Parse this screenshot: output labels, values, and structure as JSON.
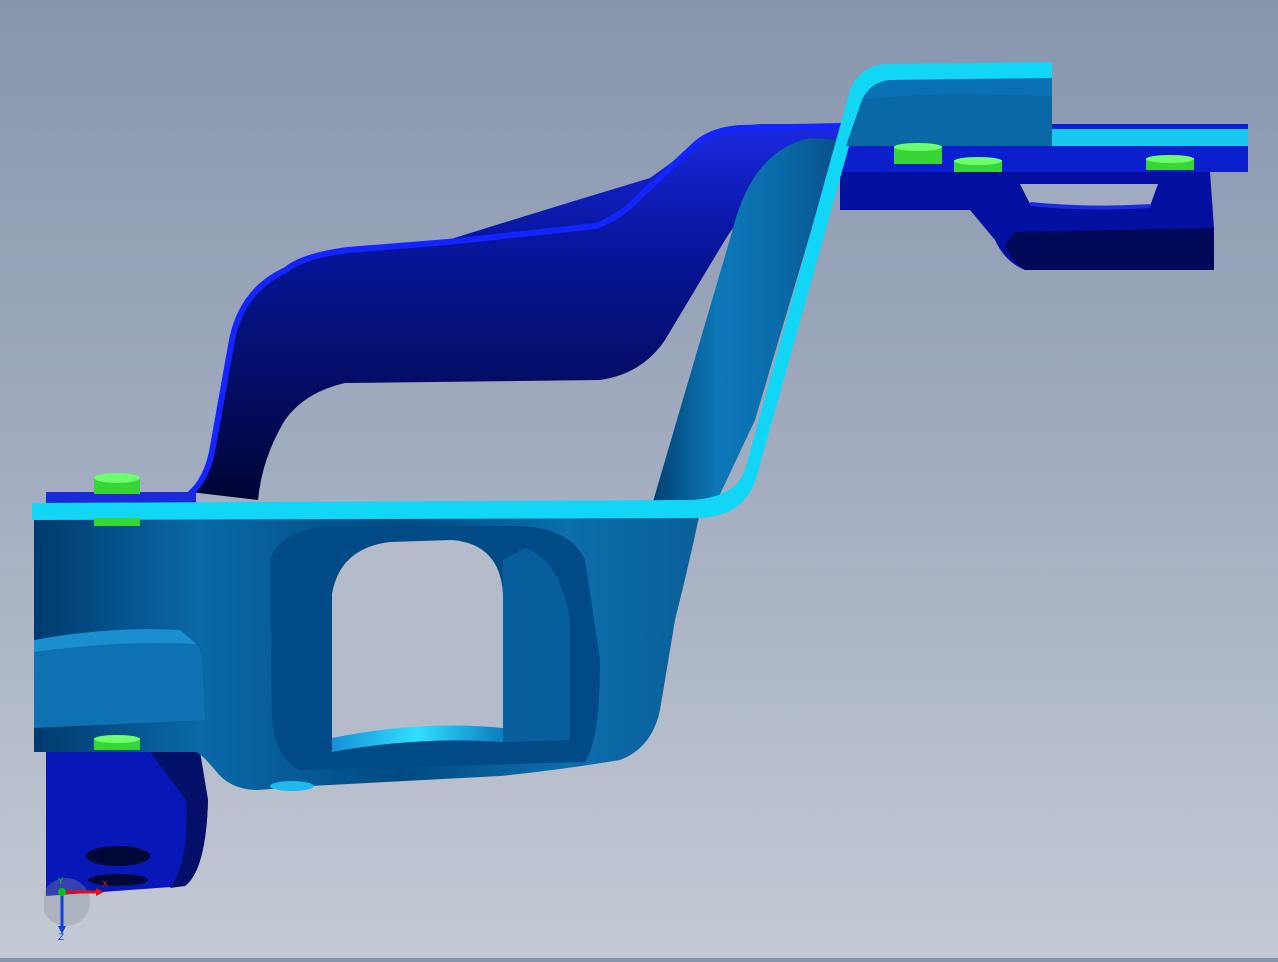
{
  "viewport": {
    "colors": {
      "background_top": "#8796ad",
      "background_bottom": "#c4cad5",
      "surface_light": "#0fd8f5",
      "surface_mid": "#0e6fb0",
      "surface_dark": "#003060",
      "back_part": "#0a14c8",
      "back_shadow": "#000a40",
      "fastener": "#3cf03c"
    }
  },
  "triad": {
    "x_label": "X",
    "y_label": "Y",
    "z_label": "Z",
    "x_color": "#e01010",
    "y_color": "#10c010",
    "z_color": "#1040e0"
  }
}
